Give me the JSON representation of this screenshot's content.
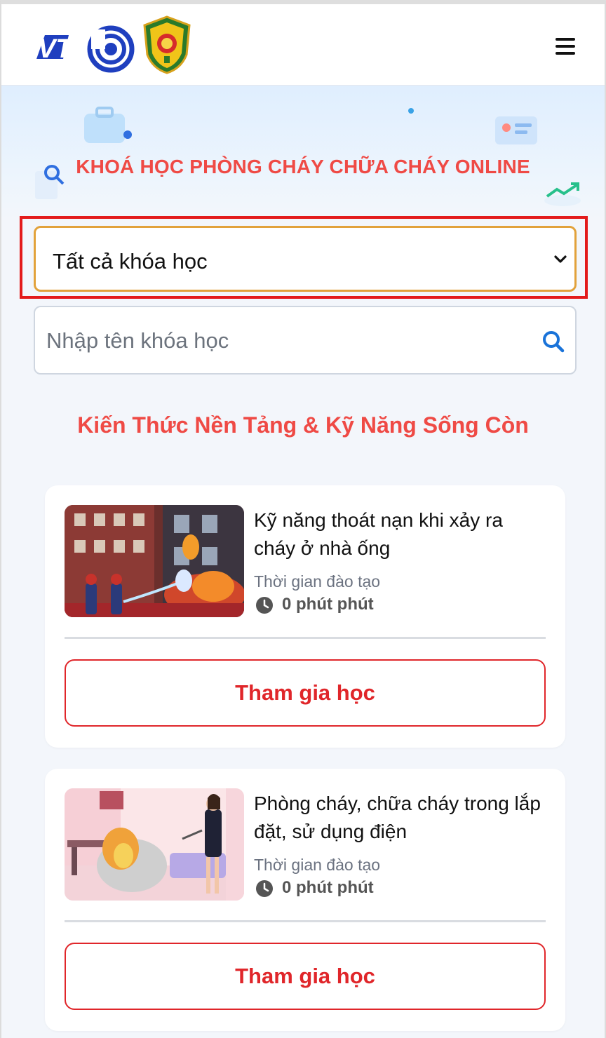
{
  "header": {
    "logo_text": "VTC",
    "menu_icon": "hamburger-menu-icon"
  },
  "hero": {
    "title": "KHOÁ HỌC PHÒNG CHÁY CHỮA CHÁY ONLINE"
  },
  "filter": {
    "selected": "Tất cả khóa học",
    "icon": "chevron-down-icon"
  },
  "search": {
    "placeholder": "Nhập tên khóa học",
    "value": "",
    "icon": "search-icon"
  },
  "section": {
    "title": "Kiến Thức Nền Tảng & Kỹ Năng Sống Còn"
  },
  "courses": [
    {
      "title": "Kỹ năng thoát nạn khi xảy ra cháy ở nhà ống",
      "duration_label": "Thời gian đào tạo",
      "duration_value": "0 phút phút",
      "button_label": "Tham gia học"
    },
    {
      "title": "Phòng cháy, chữa cháy trong lắp đặt, sử dụng điện",
      "duration_label": "Thời gian đào tạo",
      "duration_value": "0 phút phút",
      "button_label": "Tham gia học"
    }
  ],
  "colors": {
    "accent_red": "#ef4a45",
    "button_red": "#e0262a",
    "select_border": "#e2a23b",
    "highlight": "#e31b1b",
    "vtc_blue": "#1f3fbf"
  }
}
